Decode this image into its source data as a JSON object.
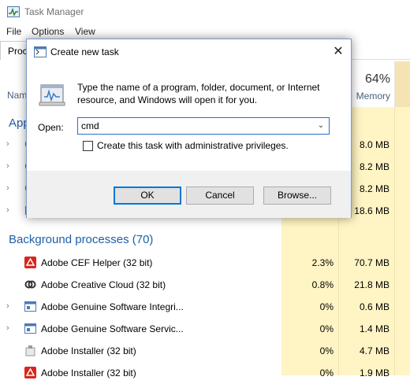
{
  "window": {
    "title": "Task Manager"
  },
  "menu": [
    "File",
    "Options",
    "View"
  ],
  "tabs": {
    "active": "Proc"
  },
  "columns": {
    "name": "Nam",
    "cpu_pct": "",
    "cpu_label": "",
    "mem_pct": "64%",
    "mem_label": "Memory"
  },
  "apps_section": "App",
  "app_rows": [
    {
      "mem": "8.0 MB"
    },
    {
      "mem": "8.2 MB"
    },
    {
      "mem": "8.2 MB"
    },
    {
      "mem": "18.6 MB"
    }
  ],
  "background_section": "Background processes (70)",
  "bg_rows": [
    {
      "name": "Adobe CEF Helper (32 bit)",
      "cpu": "2.3%",
      "mem": "70.7 MB",
      "icon": "adobe-red-icon",
      "expand": false
    },
    {
      "name": "Adobe Creative Cloud (32 bit)",
      "cpu": "0.8%",
      "mem": "21.8 MB",
      "icon": "creative-cloud-icon",
      "expand": false
    },
    {
      "name": "Adobe Genuine Software Integri...",
      "cpu": "0%",
      "mem": "0.6 MB",
      "icon": "window-app-icon",
      "expand": true
    },
    {
      "name": "Adobe Genuine Software Servic...",
      "cpu": "0%",
      "mem": "1.4 MB",
      "icon": "window-app-icon",
      "expand": true
    },
    {
      "name": "Adobe Installer (32 bit)",
      "cpu": "0%",
      "mem": "4.7 MB",
      "icon": "installer-icon",
      "expand": false
    },
    {
      "name": "Adobe Installer (32 bit)",
      "cpu": "0%",
      "mem": "1.9 MB",
      "icon": "adobe-red-icon",
      "expand": false
    }
  ],
  "dialog": {
    "title": "Create new task",
    "close": "✕",
    "description": "Type the name of a program, folder, document, or Internet resource, and Windows will open it for you.",
    "open_label": "Open:",
    "open_value": "cmd",
    "admin_label": "Create this task with administrative privileges.",
    "ok": "OK",
    "cancel": "Cancel",
    "browse": "Browse..."
  },
  "colors": {
    "accent": "#0078d7",
    "section": "#1e5fa8",
    "heat_light": "#fff4c4",
    "heat_mid": "#f9eca8",
    "column_header_heat": "#fcefc4"
  }
}
